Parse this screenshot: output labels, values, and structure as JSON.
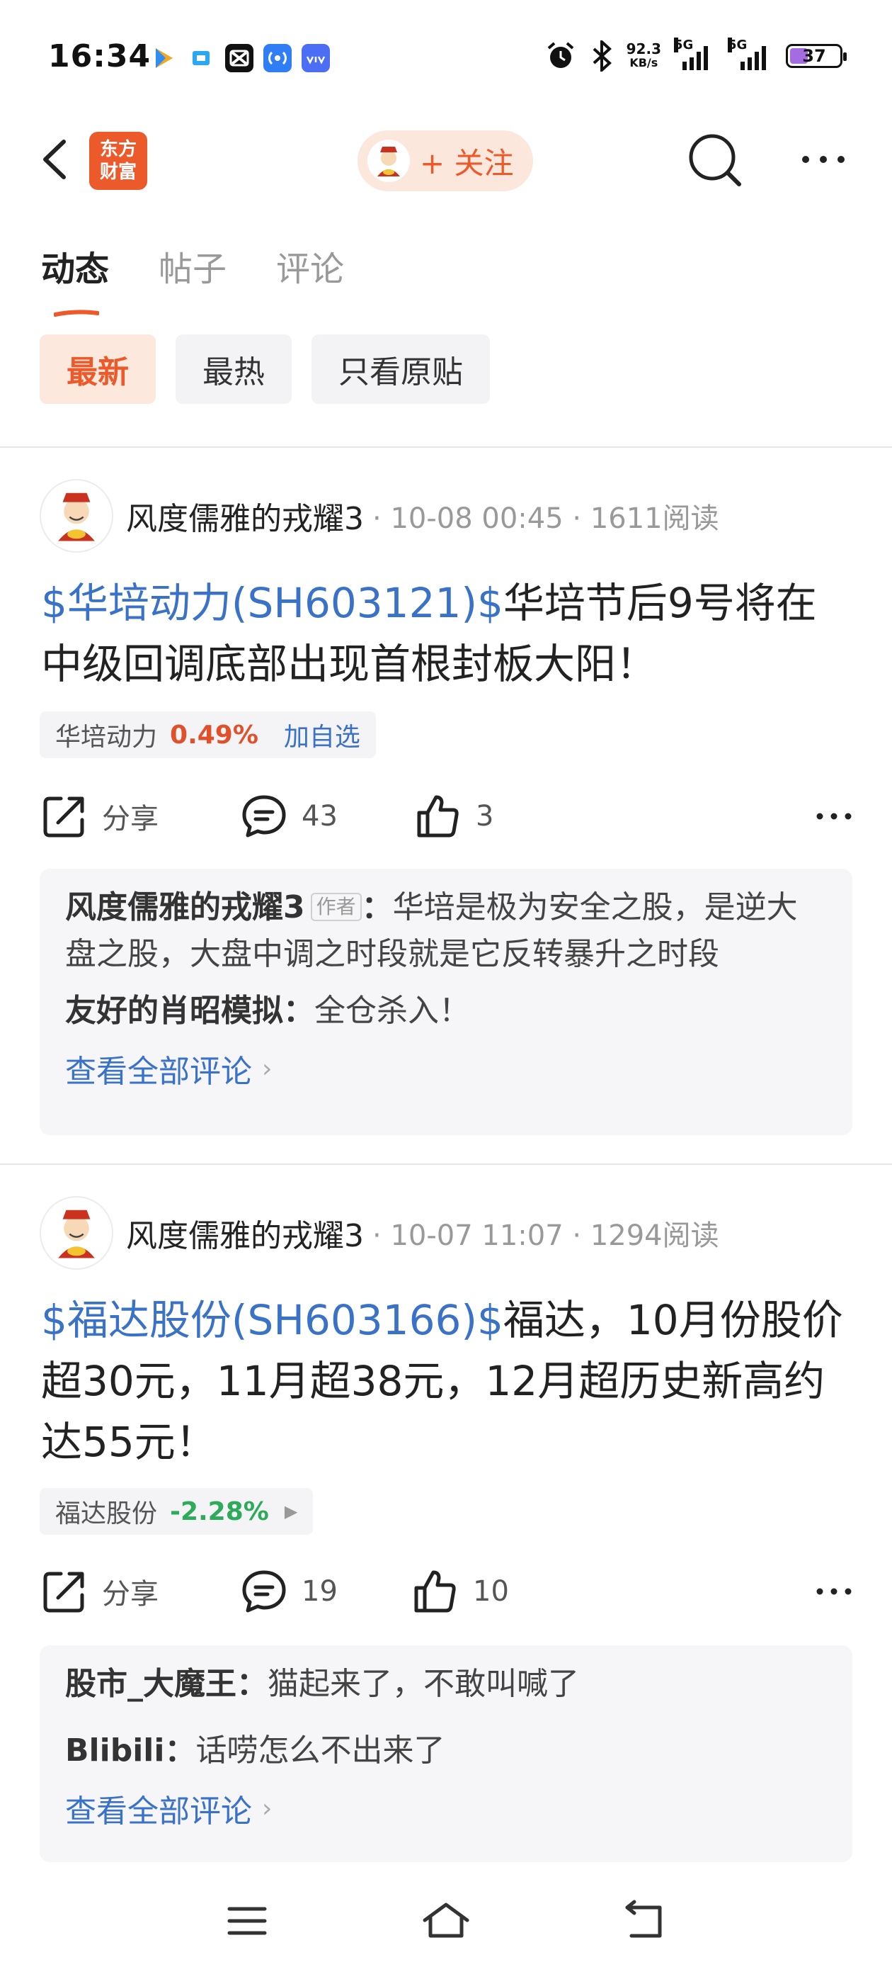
{
  "status_bar": {
    "time": "16:34",
    "net_speed_value": "92.3",
    "net_speed_unit": "KB/s",
    "signal1_label": "5G",
    "signal2_label": "5G",
    "battery": "37",
    "battery_level": 0.37
  },
  "nav": {
    "brand_logo": "东方\n财富",
    "follow_label": "+ 关注"
  },
  "tabs": [
    {
      "label": "动态",
      "active": true
    },
    {
      "label": "帖子",
      "active": false
    },
    {
      "label": "评论",
      "active": false
    }
  ],
  "filters": [
    {
      "label": "最新",
      "active": true
    },
    {
      "label": "最热",
      "active": false
    },
    {
      "label": "只看原贴",
      "active": false
    }
  ],
  "posts": [
    {
      "author": "风度儒雅的戎耀3",
      "date": "10-08 00:45",
      "reads": "1611阅读",
      "stock_link": "$华培动力(SH603121)$",
      "title_text": "华培节后9号将在中级回调底部出现首根封板大阳！",
      "stock_name": "华培动力",
      "stock_change": "0.49%",
      "stock_action": "加自选",
      "share_label": "分享",
      "comment_count": "43",
      "like_count": "3",
      "comments": [
        {
          "user": "风度儒雅的戎耀3",
          "badge": "作者",
          "text": "华培是极为安全之股，是逆大盘之股，大盘中调之时段就是它反转暴升之时段"
        },
        {
          "user": "友好的肖昭模拟",
          "text": "全仓杀入！"
        }
      ],
      "view_all": "查看全部评论"
    },
    {
      "author": "风度儒雅的戎耀3",
      "date": "10-07 11:07",
      "reads": "1294阅读",
      "stock_link": "$福达股份(SH603166)$",
      "title_text": "福达，10月份股价超30元，11月超38元，12月超历史新高约达55元！",
      "stock_name": "福达股份",
      "stock_change": "-2.28%",
      "share_label": "分享",
      "comment_count": "19",
      "like_count": "10",
      "comments": [
        {
          "user": "股市_大魔王",
          "text": "猫起来了，不敢叫喊了"
        },
        {
          "user": "Blibili",
          "text": "话唠怎么不出来了"
        }
      ],
      "view_all": "查看全部评论"
    }
  ],
  "colors": {
    "accent": "#ec5a2c",
    "link": "#3a72c7",
    "up": "#e0502a",
    "down": "#2eaa5b"
  }
}
